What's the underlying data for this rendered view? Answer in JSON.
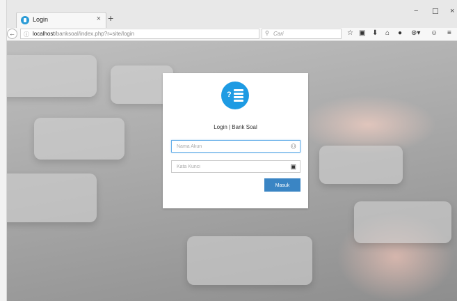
{
  "browser": {
    "tab_title": "Login",
    "tab_close": "×",
    "new_tab": "+",
    "window_controls": {
      "minimize": "−",
      "maximize": "☐",
      "close": "×"
    },
    "back": "←",
    "info_icon": "ⓘ",
    "url_host": "localhost",
    "url_path": "/banksoal/index.php?r=site/login",
    "reload": "↻",
    "search_placeholder": "Cari",
    "toolbar_icons": [
      "star-icon",
      "clipboard-icon",
      "download-icon",
      "home-icon",
      "chat-icon",
      "extension-icon",
      "smiley-icon",
      "menu-icon"
    ],
    "toolbar_glyphs": {
      "star": "☆",
      "clipboard": "▣",
      "download": "⬇",
      "home": "⌂",
      "chat": "●",
      "extension": "⊛▾",
      "smiley": "☺",
      "menu": "≡"
    }
  },
  "login": {
    "title": "Login | Bank Soal",
    "username_placeholder": "Nama Akun",
    "password_placeholder": "Kata Kunci",
    "user_icon": "👤",
    "lock_icon": "🔒",
    "submit_label": "Masuk",
    "logo_question": "?",
    "accent_color": "#1e9be3",
    "button_color": "#3a85c4"
  }
}
